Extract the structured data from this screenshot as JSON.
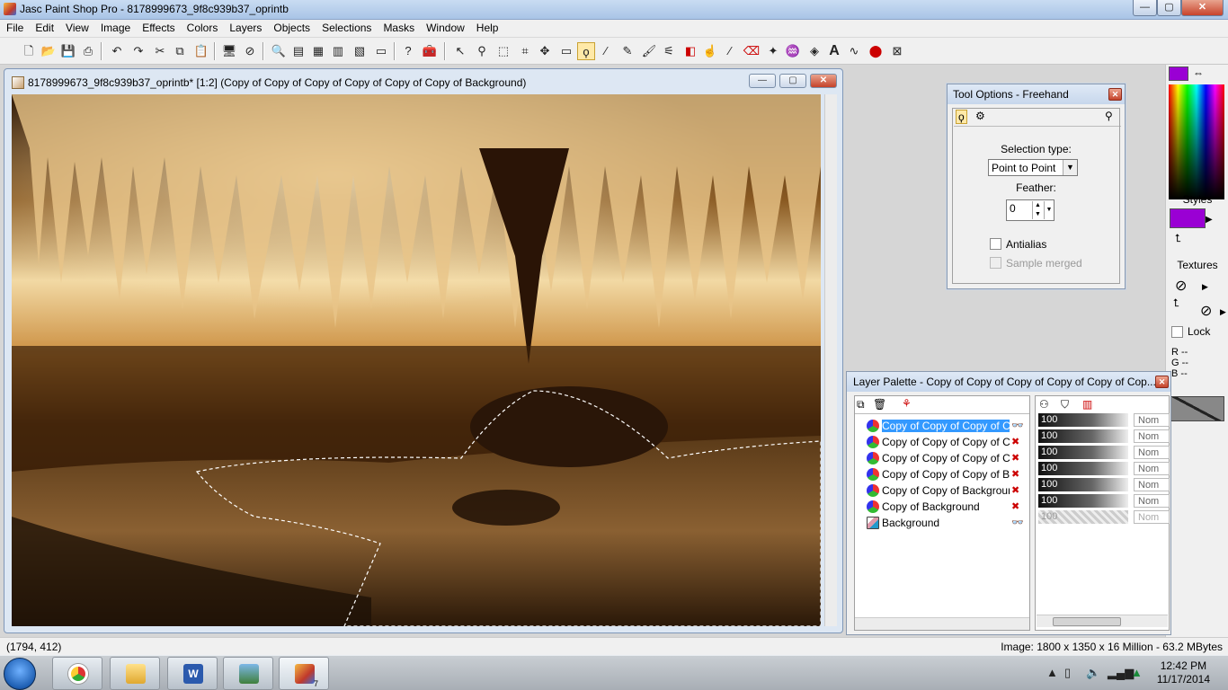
{
  "window": {
    "title": "Jasc Paint Shop Pro - 8178999673_9f8c939b37_oprintb",
    "min": "—",
    "max": "▢",
    "close": "✕"
  },
  "menu": [
    "File",
    "Edit",
    "View",
    "Image",
    "Effects",
    "Colors",
    "Layers",
    "Objects",
    "Selections",
    "Masks",
    "Window",
    "Help"
  ],
  "toolbar_icons": [
    "new-icon",
    "open-icon",
    "save-icon",
    "print-icon",
    "undo-icon",
    "redo-icon",
    "cut-icon",
    "copy-icon",
    "paste-icon",
    "browse-icon",
    "cancel-icon",
    "zoom-icon",
    "overview-icon",
    "histogram-icon",
    "color-palette-icon",
    "layers-icon",
    "window-icon",
    "help-icon",
    "toolbox-icon",
    "arrow-tool-icon",
    "zoom-tool-icon",
    "deform-icon",
    "crop-icon",
    "mover-icon",
    "selection-icon",
    "freehand-icon",
    "magic-wand-icon",
    "dropper-icon",
    "paint-brush-icon",
    "clone-icon",
    "color-replacer-icon",
    "retouch-icon",
    "scratch-remover-icon",
    "eraser-icon",
    "picture-tube-icon",
    "airbrush-icon",
    "flood-fill-icon",
    "text-icon",
    "draw-icon",
    "preset-shapes-icon",
    "object-selector-icon"
  ],
  "document": {
    "title": "8178999673_9f8c939b37_oprintb* [1:2] (Copy of Copy of Copy of Copy of Copy of Copy of Background)"
  },
  "status": {
    "coords": "(1794, 412)",
    "image_info": "Image:  1800 x 1350 x 16 Million - 63.2 MBytes"
  },
  "tool_options": {
    "title": "Tool Options - Freehand",
    "selection_type_label": "Selection type:",
    "selection_type_value": "Point to Point",
    "feather_label": "Feather:",
    "feather_value": "0",
    "antialias_label": "Antialias",
    "sample_merged_label": "Sample merged"
  },
  "layer_palette": {
    "title": "Layer Palette - Copy of Copy of Copy of Copy of Copy of Cop...",
    "layers": [
      {
        "name": "Copy of Copy of Copy of Co...",
        "opacity": "100",
        "mode": "Nom"
      },
      {
        "name": "Copy of Copy of Copy of Co...",
        "opacity": "100",
        "mode": "Nom"
      },
      {
        "name": "Copy of Copy of Copy of Co...",
        "opacity": "100",
        "mode": "Nom"
      },
      {
        "name": "Copy of Copy of Copy of Ba...",
        "opacity": "100",
        "mode": "Nom"
      },
      {
        "name": "Copy of Copy of Background",
        "opacity": "100",
        "mode": "Nom"
      },
      {
        "name": "Copy of Background",
        "opacity": "100",
        "mode": "Nom"
      },
      {
        "name": "Background",
        "opacity": "100",
        "mode": "Nom"
      }
    ]
  },
  "color_panel": {
    "styles_label": "Styles",
    "textures_label": "Textures",
    "lock_label": "Lock",
    "fg_color": "#9a00d4",
    "r_label": "R",
    "g_label": "G",
    "b_label": "B",
    "r_value": "--",
    "g_value": "--",
    "b_value": "--"
  },
  "taskbar": {
    "time": "12:42 PM",
    "date": "11/17/2014",
    "psp_count": "7"
  }
}
